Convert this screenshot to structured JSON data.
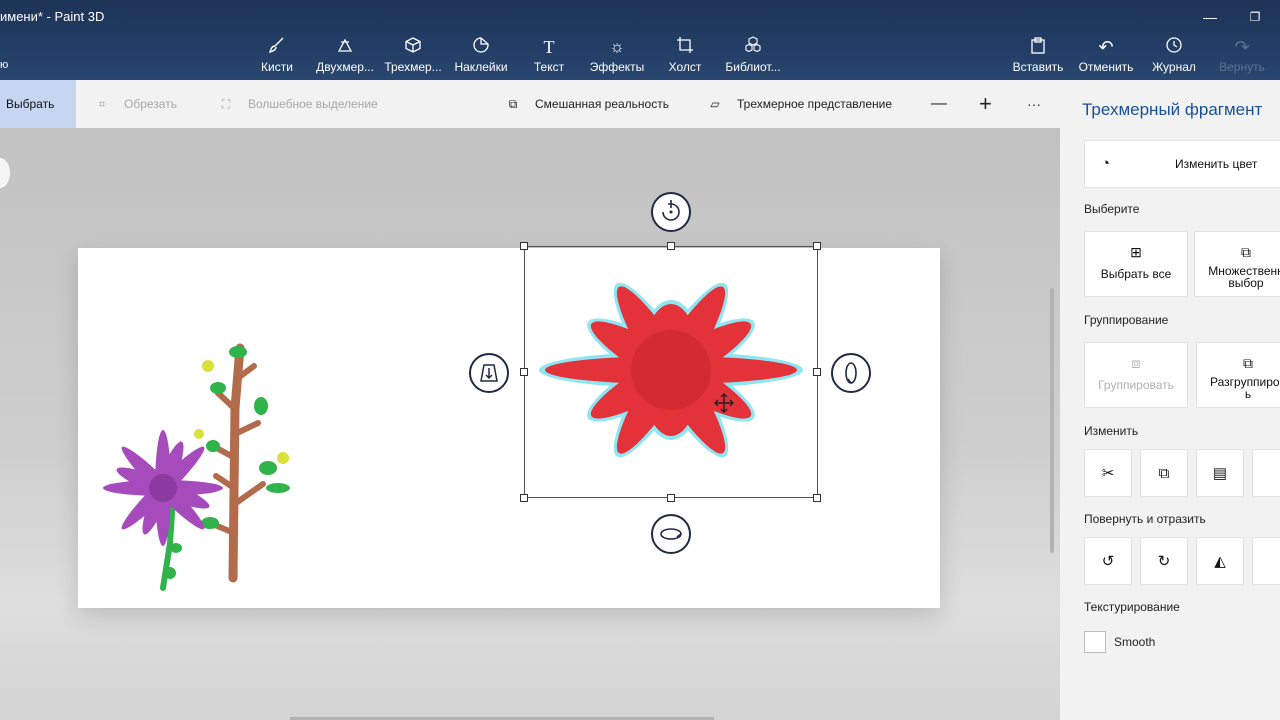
{
  "window": {
    "title": "имени* - Paint 3D",
    "left_stub": "ю",
    "minimize": "—",
    "restore": "❐"
  },
  "ribbon": {
    "tools": [
      {
        "id": "brushes",
        "label": "Кисти",
        "icon": "brush-icon"
      },
      {
        "id": "2d",
        "label": "Двухмер...",
        "icon": "2d-shapes-icon"
      },
      {
        "id": "3d",
        "label": "Трехмер...",
        "icon": "3d-shapes-icon"
      },
      {
        "id": "stickers",
        "label": "Наклейки",
        "icon": "stickers-icon"
      },
      {
        "id": "text",
        "label": "Текст",
        "icon": "text-icon"
      },
      {
        "id": "effects",
        "label": "Эффекты",
        "icon": "effects-icon"
      },
      {
        "id": "canvas",
        "label": "Холст",
        "icon": "canvas-icon"
      },
      {
        "id": "library",
        "label": "Библиот...",
        "icon": "library-icon"
      }
    ],
    "actions": [
      {
        "id": "paste",
        "label": "Вставить",
        "icon": "paste-icon",
        "enabled": true
      },
      {
        "id": "undo",
        "label": "Отменить",
        "icon": "undo-icon",
        "enabled": true
      },
      {
        "id": "history",
        "label": "Журнал",
        "icon": "history-icon",
        "enabled": true
      },
      {
        "id": "redo",
        "label": "Вернуть",
        "icon": "redo-icon",
        "enabled": false
      }
    ]
  },
  "subbar": {
    "select": "Выбрать",
    "crop": "Обрезать",
    "magic_select": "Волшебное выделение",
    "mixed_reality": "Смешанная реальность",
    "view_3d": "Трехмерное представление",
    "zoom_out": "—",
    "zoom_in": "+",
    "more": "···"
  },
  "panel": {
    "title": "Трехмерный фрагмент",
    "change_color": "Изменить цвет",
    "select_section": "Выберите",
    "select_all": "Выбрать все",
    "multi_select_1": "Множественн",
    "multi_select_2": "выбор",
    "group_section": "Группирование",
    "group": "Группировать",
    "ungroup_1": "Разгруппиров",
    "ungroup_2": "ь",
    "edit_section": "Изменить",
    "rotate_section": "Повернуть и отразить",
    "texture_section": "Текстурирование",
    "smooth": "Smooth"
  },
  "colors": {
    "ribbon": "#233e66",
    "accent": "#1a4f98",
    "flower_red": "#e3323a",
    "glow": "#8fe6f2",
    "flower_purple": "#a64bbb",
    "stem_brown": "#b26c4c",
    "leaf_green": "#2fb34a"
  }
}
